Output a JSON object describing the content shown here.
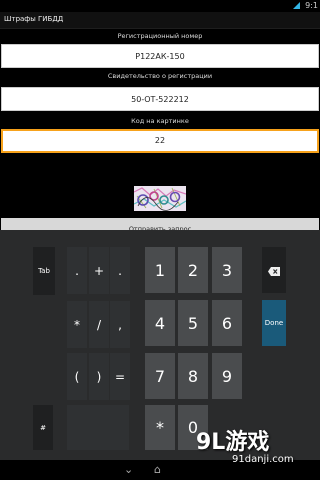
{
  "status": {
    "time": "9:1"
  },
  "app": {
    "title": "Штрафы ГИБДД"
  },
  "form": {
    "reg_label": "Регистрационный номер",
    "reg_value": "Р122АК-150",
    "cert_label": "Свидетельство о регистрации",
    "cert_value": "50-ОТ-522212",
    "code_label": "Код на картинке",
    "code_value": "22",
    "submit_label": "Отправить запрос"
  },
  "keyboard": {
    "tab": "Tab",
    "dot1": ".",
    "plus": "+",
    "dot2": ".",
    "star": "*",
    "slash": "/",
    "comma": ",",
    "lparen": "(",
    "rparen": ")",
    "equals": "=",
    "hash": "#",
    "n1": "1",
    "n2": "2",
    "n3": "3",
    "n4": "4",
    "n5": "5",
    "n6": "6",
    "n7": "7",
    "n8": "8",
    "n9": "9",
    "star2": "*",
    "n0": "0",
    "done": "Done"
  },
  "watermark": {
    "logo": "9L游戏",
    "url": "91danji.com"
  },
  "icons": {
    "backspace": "backspace-icon",
    "nav_back": "back-icon",
    "nav_home": "home-icon"
  }
}
